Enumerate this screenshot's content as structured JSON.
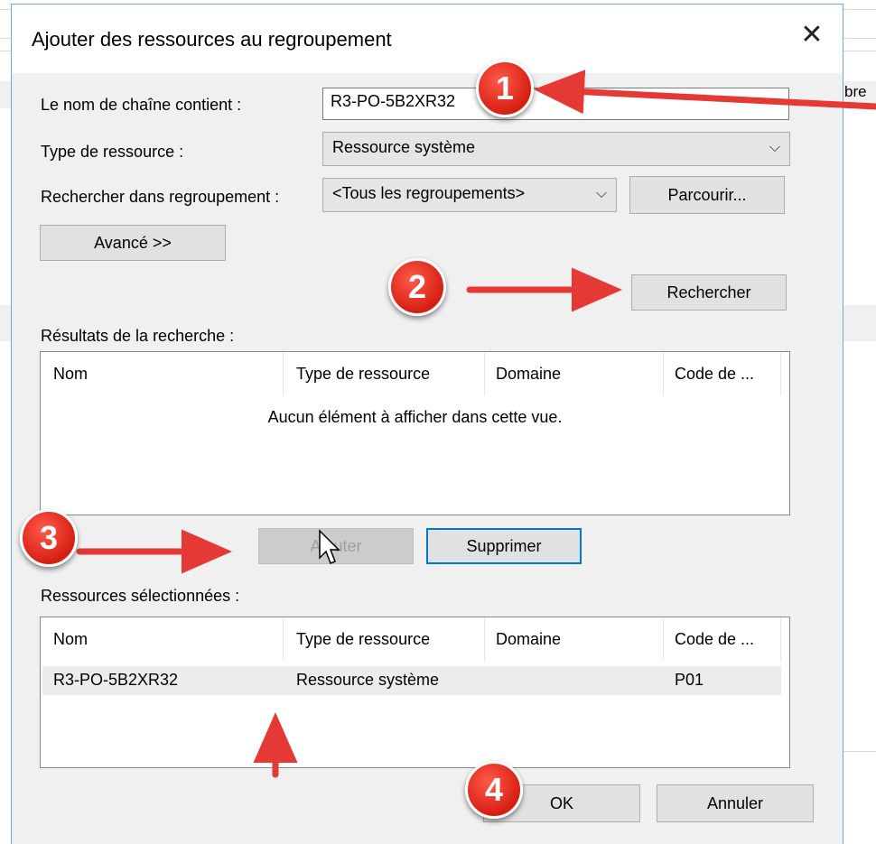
{
  "background": {
    "partial_text": "bre"
  },
  "dialog": {
    "title": "Ajouter des ressources au regroupement",
    "close_glyph": "✕",
    "name_label": "Le nom de chaîne contient :",
    "name_value": "R3-PO-5B2XR32",
    "type_label": "Type de ressource :",
    "type_value": "Ressource système",
    "search_in_label": "Rechercher dans regroupement :",
    "search_in_value": "<Tous les regroupements>",
    "browse_label": "Parcourir...",
    "advanced_label": "Avancé >>",
    "search_button_label": "Rechercher",
    "results_label": "Résultats de la recherche :",
    "columns": [
      "Nom",
      "Type de ressource",
      "Domaine",
      "Code de ..."
    ],
    "empty_message": "Aucun élément à afficher dans cette vue.",
    "add_label": "Ajouter",
    "remove_label": "Supprimer",
    "selected_label": "Ressources sélectionnées :",
    "selected_rows": [
      {
        "nom": "R3-PO-5B2XR32",
        "type": "Ressource système",
        "domaine": "",
        "code": "P01"
      }
    ],
    "ok_label": "OK",
    "cancel_label": "Annuler",
    "chevron_glyph": "⌵"
  },
  "annotations": {
    "step1": "1",
    "step2": "2",
    "step3": "3",
    "step4": "4",
    "color": "#e53935"
  }
}
